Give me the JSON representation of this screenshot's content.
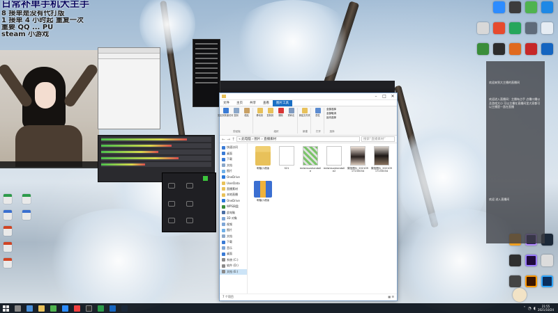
{
  "stream_overlay": {
    "title": "日常补单手机大主手",
    "lines": [
      "8 接单是没有代打版",
      "1 接单 4 小时起   重复一次",
      "重要 QQ ... PU",
      "steam 小游戏"
    ]
  },
  "explorer": {
    "tabs": [
      "文件",
      "主页",
      "共享",
      "查看",
      "图片工具"
    ],
    "active_tab": "图片工具",
    "ribbon_groups": [
      {
        "label": "剪贴板",
        "buttons": [
          "固定到快速访问",
          "复制",
          "粘贴"
        ]
      },
      {
        "label": "组织",
        "buttons": [
          "移动到",
          "复制到",
          "删除",
          "重命名"
        ]
      },
      {
        "label": "新建",
        "buttons": [
          "新建文件夹"
        ]
      },
      {
        "label": "打开",
        "buttons": [
          "属性"
        ]
      },
      {
        "label": "选择",
        "buttons": [
          "全部选择",
          "全部取消",
          "反向选择"
        ]
      }
    ],
    "address": "« 此电脑 › 图片 › 直播素材",
    "search_placeholder": "搜索“直播素材”",
    "nav_items": [
      "快速访问",
      "桌面",
      "下载",
      "文档",
      "图片",
      "OneDrive",
      "UserData",
      "直播素材",
      "本地直播",
      "OneDrive",
      "WPS网盘",
      "此电脑",
      "3D 对象",
      "视频",
      "图片",
      "文档",
      "下载",
      "音乐",
      "桌面",
      "系统 (C:)",
      "软件 (D:)",
      "文档 (E:)"
    ],
    "selected_nav": "文档 (E:)",
    "files": [
      {
        "name": "明楷小说版",
        "kind": "folder"
      },
      {
        "name": "S21",
        "kind": "doc"
      },
      {
        "name": "mdsmsushandolle",
        "kind": "image"
      },
      {
        "name": "mdsmsushandolle2",
        "kind": "doc"
      },
      {
        "name": "微信图片_20210917155034",
        "kind": "photo"
      },
      {
        "name": "微信图片_20210917155034",
        "kind": "photo2"
      },
      {
        "name": "明楷小说版",
        "kind": "archive"
      }
    ],
    "status": "7 个项目"
  },
  "chat": {
    "messages": [
      "欢迎来到大主播的直播间",
      "欢迎进入直播间：主播有点手 点播口播以及游戏大小 可以主播在直播间里大家都可以主播是一直在直播",
      "欢迎 进入直播间"
    ]
  },
  "taskbar": {
    "time": "21:55",
    "date": "2021/10/24"
  },
  "colors": {
    "accent": "#1a6fc4",
    "folder": "#e8c15a",
    "taskbar": "#141a22"
  }
}
